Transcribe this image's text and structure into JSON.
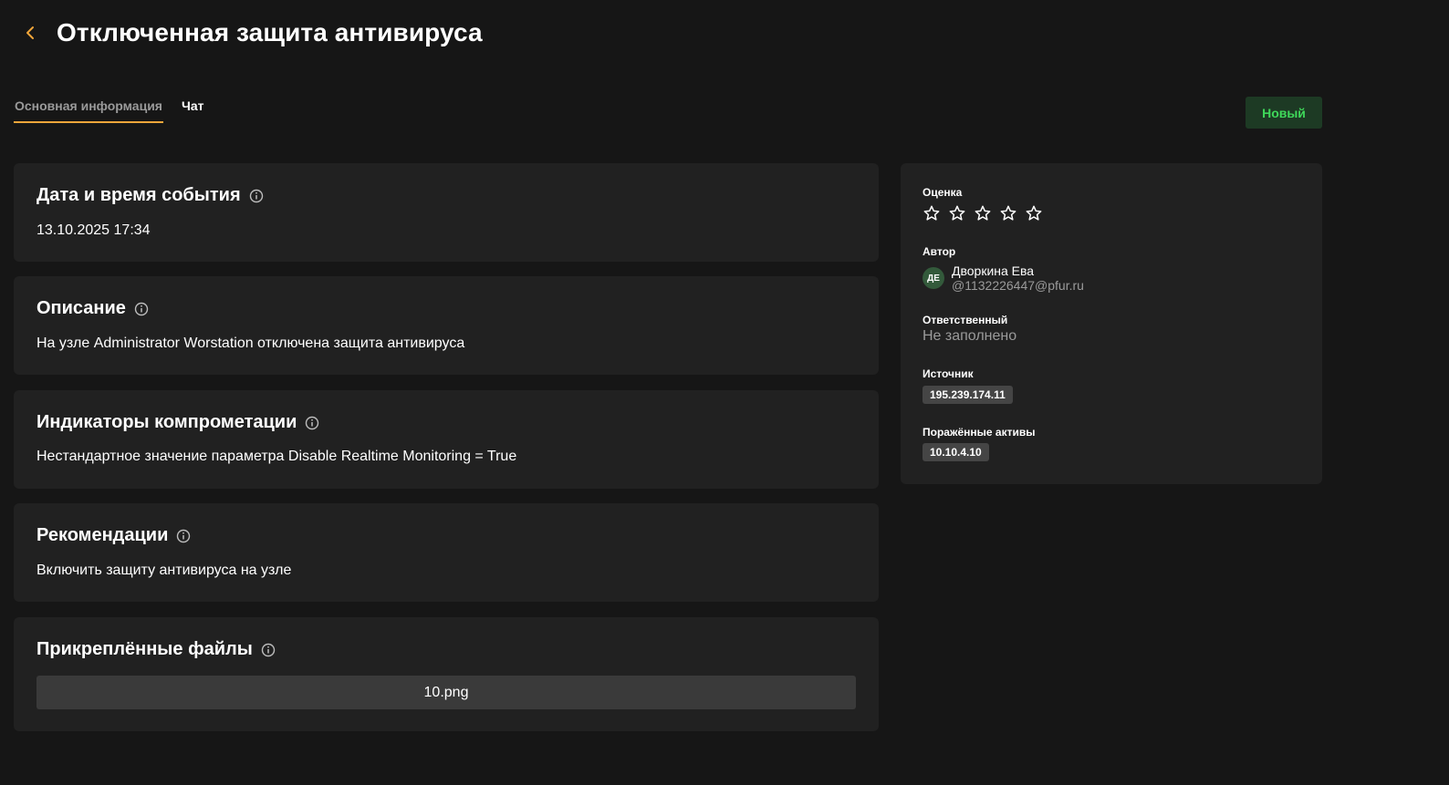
{
  "header": {
    "title": "Отключенная защита антивируса"
  },
  "tabs": [
    {
      "label": "Основная информация",
      "active": true
    },
    {
      "label": "Чат",
      "active": false
    }
  ],
  "status_badge": "Новый",
  "cards": {
    "datetime": {
      "title": "Дата и время события",
      "text": "13.10.2025 17:34"
    },
    "description": {
      "title": "Описание",
      "text": "На узле Administrator Worstation отключена защита антивируса"
    },
    "indicators": {
      "title": "Индикаторы компрометации",
      "text": "Нестандартное значение параметра Disable Realtime Monitoring = True"
    },
    "recommendations": {
      "title": "Рекомендации",
      "text": "Включить защиту антивируса на узле"
    },
    "attachments": {
      "title": "Прикреплённые файлы",
      "files": [
        "10.png"
      ]
    }
  },
  "sidebar": {
    "rating_label": "Оценка",
    "rating_value": 0,
    "rating_max": 5,
    "author_label": "Автор",
    "author": {
      "initials": "ДЕ",
      "name": "Дворкина Ева",
      "email": "@1132226447@pfur.ru"
    },
    "assignee_label": "Ответственный",
    "assignee_value": "Не заполнено",
    "source_label": "Источник",
    "source_value": "195.239.174.11",
    "assets_label": "Поражённые активы",
    "assets_value": "10.10.4.10"
  },
  "colors": {
    "background": "#161616",
    "card": "#212121",
    "accent": "#f0a63a",
    "status_text": "#3fd85a",
    "status_bg": "#1d3a24"
  },
  "icons": [
    "back-chevron-icon",
    "info-icon",
    "star-outline-icon"
  ]
}
